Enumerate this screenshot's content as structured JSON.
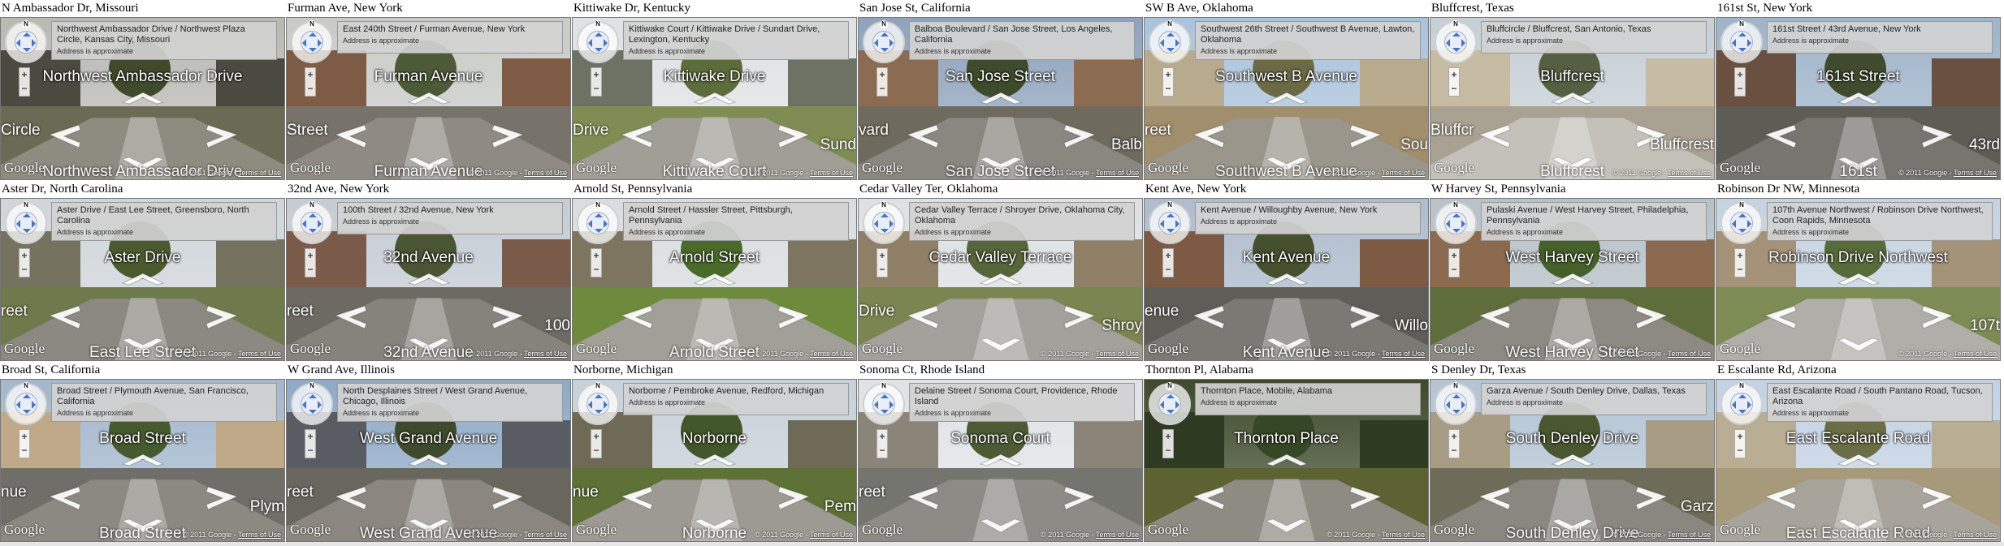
{
  "map": {
    "approx_label": "Address is approximate",
    "google_logo": "Google",
    "copyright": "© 2011 Google",
    "terms": "Terms of Use",
    "zoom_in": "+",
    "zoom_out": "−",
    "compass_n": "N"
  },
  "cells": [
    {
      "caption": "N Ambassador Dr, Missouri",
      "address": "Northwest Ambassador Drive / Northwest Plaza Circle, Kansas City, Missouri",
      "street": "Northwest Ambassador Drive",
      "street2": "Northwest Ambassador Drive",
      "sideL": "Circle",
      "sideR": "",
      "sky": "#b9b9b4",
      "ground": "#6b6a55",
      "road": "#8e8b80",
      "bldg": "#4b4a40",
      "tree": "#3e4a2a"
    },
    {
      "caption": "Furman Ave, New York",
      "address": "East 240th Street / Furman Avenue, New York",
      "street": "Furman Avenue",
      "street2": "Furman Avenue",
      "sideL": "Street",
      "sideR": "",
      "sky": "#c9cbc7",
      "ground": "#77726a",
      "road": "#8f8b84",
      "bldg": "#7d5b44",
      "tree": "#4d5a37"
    },
    {
      "caption": "Kittiwake Dr, Kentucky",
      "address": "Kittiwake Court / Kittiwake Drive / Sundart Drive, Lexington, Kentucky",
      "street": "Kittiwake Drive",
      "street2": "Kittiwake Court",
      "sideL": "Drive",
      "sideR": "Sund",
      "sky": "#dfe2e4",
      "ground": "#7f8d55",
      "road": "#a09e96",
      "bldg": "#6d7265",
      "tree": "#5c6d3b"
    },
    {
      "caption": "San Jose St, California",
      "address": "Balboa Boulevard / San Jose Street, Los Angeles, California",
      "street": "San Jose Street",
      "street2": "San Jose Street",
      "sideL": "vard",
      "sideR": "Balb",
      "sky": "#8fa3bd",
      "ground": "#6f6a5e",
      "road": "#8a8680",
      "bldg": "#8b6c53",
      "tree": "#3d4a2b"
    },
    {
      "caption": "SW B Ave, Oklahoma",
      "address": "Southwest 26th Street / Southwest B Avenue, Lawton, Oklahoma",
      "street": "Southwest B Avenue",
      "street2": "Southwest B Avenue",
      "sideL": "reet",
      "sideR": "Sou",
      "sky": "#a9c3dc",
      "ground": "#a08e6c",
      "road": "#9a968c",
      "bldg": "#b8aa8c",
      "tree": "#6b6a45"
    },
    {
      "caption": "Bluffcrest, Texas",
      "address": "Bluffcircle / Bluffcrest, San Antonio, Texas",
      "street": "Bluffcrest",
      "street2": "Bluffcrest",
      "sideL": "Bluffcr",
      "sideR": "Bluffcrest",
      "sky": "#c6cfd6",
      "ground": "#a9a292",
      "road": "#c4c1ba",
      "bldg": "#c8bba4",
      "tree": "#556043"
    },
    {
      "caption": "161st St, New York",
      "address": "161st Street / 43rd Avenue, New York",
      "street": "161st Street",
      "street2": "161st",
      "sideL": "",
      "sideR": "43rd",
      "sky": "#9fb4c9",
      "ground": "#5d5c55",
      "road": "#77756f",
      "bldg": "#6a5040",
      "tree": "#3f4b2c"
    },
    {
      "caption": "Aster Dr, North Carolina",
      "address": "Aster Drive / East Lee Street, Greensboro, North Carolina",
      "street": "Aster Drive",
      "street2": "East Lee Street",
      "sideL": "reet",
      "sideR": "",
      "sky": "#cfd5da",
      "ground": "#6f7a4c",
      "road": "#8b8981",
      "bldg": "#75735f",
      "tree": "#4b5a2e"
    },
    {
      "caption": "32nd Ave, New York",
      "address": "100th Street / 32nd Avenue, New York",
      "street": "32nd Avenue",
      "street2": "32nd Avenue",
      "sideL": "reet",
      "sideR": "100",
      "sky": "#c5ccd4",
      "ground": "#6c6a63",
      "road": "#85837c",
      "bldg": "#7a5a48",
      "tree": "#4a5534"
    },
    {
      "caption": "Arnold St, Pennsylvania",
      "address": "Arnold Street / Hassler Street, Pittsburgh, Pennsylvania",
      "street": "Arnold Street",
      "street2": "Arnold Street",
      "sideL": "",
      "sideR": "",
      "sky": "#d9dde0",
      "ground": "#6d8a3d",
      "road": "#a19f97",
      "bldg": "#7e7561",
      "tree": "#4a6a2a"
    },
    {
      "caption": "Cedar Valley Ter, Oklahoma",
      "address": "Cedar Valley Terrace / Shroyer Drive, Oklahoma City, Oklahoma",
      "street": "Cedar Valley Terrace",
      "street2": "",
      "sideL": "Drive",
      "sideR": "Shroy",
      "sky": "#dde1e3",
      "ground": "#7b8552",
      "road": "#a3a19b",
      "bldg": "#8f7f66",
      "tree": "#57653a"
    },
    {
      "caption": "Kent Ave, New York",
      "address": "Kent Avenue / Willoughby Avenue, New York",
      "street": "Kent Avenue",
      "street2": "Kent Avenue",
      "sideL": "enue",
      "sideR": "Willo",
      "sky": "#aebccc",
      "ground": "#5f5d58",
      "road": "#7b7973",
      "bldg": "#7c5a43",
      "tree": "#45502f"
    },
    {
      "caption": "W Harvey St, Pennsylvania",
      "address": "Pulaski Avenue / West Harvey Street, Philadelphia, Pennsylvania",
      "street": "West Harvey Street",
      "street2": "West Harvey Street",
      "sideL": "",
      "sideR": "",
      "sky": "#b7c1c8",
      "ground": "#5f6d3c",
      "road": "#8c8a83",
      "bldg": "#8b6a4f",
      "tree": "#45602a"
    },
    {
      "caption": "Robinson Dr NW, Minnesota",
      "address": "107th Avenue Northwest / Robinson Drive Northwest, Coon Rapids, Minnesota",
      "street": "Robinson Drive Northwest",
      "street2": "",
      "sideL": "",
      "sideR": "107t",
      "sky": "#c5d3e0",
      "ground": "#7d8b55",
      "road": "#b0aea8",
      "bldg": "#a49378",
      "tree": "#586b3a"
    },
    {
      "caption": "Broad St, California",
      "address": "Broad Street / Plymouth Avenue, San Francisco, California",
      "street": "Broad Street",
      "street2": "Broad Street",
      "sideL": "nue",
      "sideR": "Plym",
      "sky": "#a3b7cd",
      "ground": "#6f6e68",
      "road": "#8b8982",
      "bldg": "#c0a989",
      "tree": "#465a2f"
    },
    {
      "caption": "W Grand Ave, Illinois",
      "address": "North Desplaines Street / West Grand Avenue, Chicago, Illinois",
      "street": "West Grand Avenue",
      "street2": "West Grand Avenue",
      "sideL": "reet",
      "sideR": "",
      "sky": "#8fa9c6",
      "ground": "#69665e",
      "road": "#8b8780",
      "bldg": "#5a5c63",
      "tree": "#3f4a2c"
    },
    {
      "caption": "Norborne, Michigan",
      "address": "Norborne / Pembroke Avenue, Redford, Michigan",
      "street": "Norborne",
      "street2": "Norborne",
      "sideL": "nue",
      "sideR": "Pem",
      "sky": "#c7d1d9",
      "ground": "#5e7136",
      "road": "#9c9a92",
      "bldg": "#6e6a55",
      "tree": "#42572a"
    },
    {
      "caption": "Sonoma Ct, Rhode Island",
      "address": "Delaine Street / Sonoma Court, Providence, Rhode Island",
      "street": "Sonoma Court",
      "street2": "",
      "sideL": "reet",
      "sideR": "",
      "sky": "#dfe3e7",
      "ground": "#757570",
      "road": "#8d8b86",
      "bldg": "#8a8578",
      "tree": "#4d5b35"
    },
    {
      "caption": "Thornton Pl, Alabama",
      "address": "Thornton Place, Mobile, Alabama",
      "street": "Thornton Place",
      "street2": "",
      "sideL": "",
      "sideR": "",
      "sky": "#3e4a2c",
      "ground": "#5d6233",
      "road": "#8e8b82",
      "bldg": "#2f3a22",
      "tree": "#364726"
    },
    {
      "caption": "S Denley Dr, Texas",
      "address": "Garza Avenue / South Denley Drive, Dallas, Texas",
      "street": "South Denley Drive",
      "street2": "South Denley Drive",
      "sideL": "",
      "sideR": "Garz",
      "sky": "#b3c4d4",
      "ground": "#6e6c58",
      "road": "#8a8781",
      "bldg": "#a89c84",
      "tree": "#49562f"
    },
    {
      "caption": "E Escalante Rd, Arizona",
      "address": "East Escalante Road / South Pantano Road, Tucson, Arizona",
      "street": "East Escalante Road",
      "street2": "East Escalante Road",
      "sideL": "",
      "sideR": "",
      "sky": "#c3d2e3",
      "ground": "#a69a7a",
      "road": "#a8a49c",
      "bldg": "#b9ad94",
      "tree": "#6a6d45"
    }
  ]
}
